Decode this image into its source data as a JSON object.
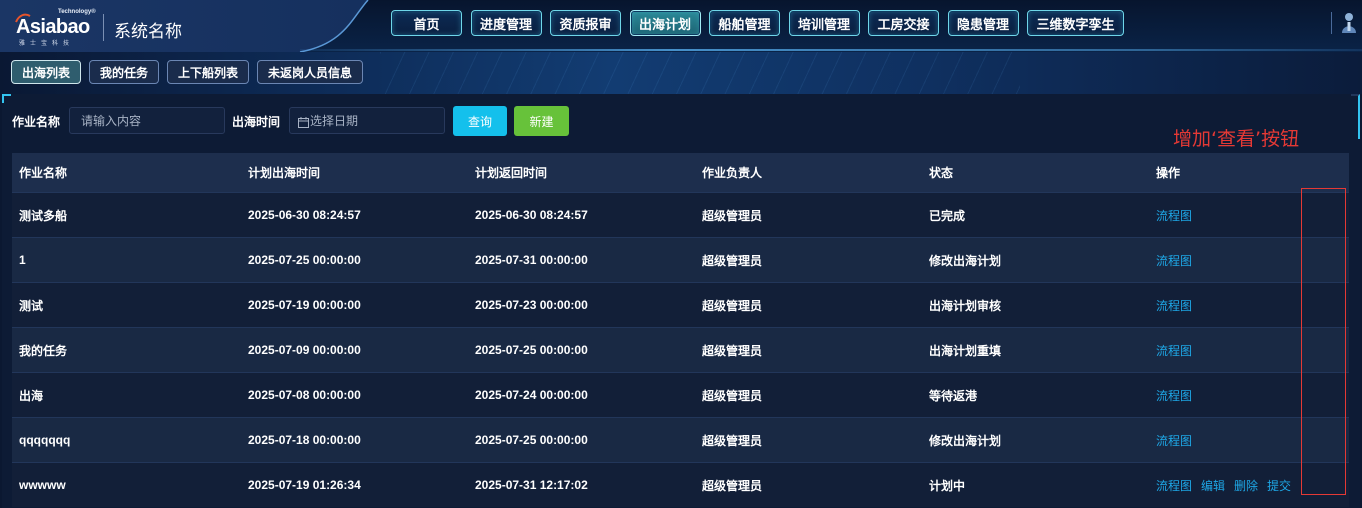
{
  "logo": {
    "brand": "Asiabao",
    "tagline": "Technology®",
    "subtitle": "雅士宝科技"
  },
  "system_name": "系统名称",
  "nav": [
    {
      "label": "首页"
    },
    {
      "label": "进度管理"
    },
    {
      "label": "资质报审"
    },
    {
      "label": "出海计划",
      "active": true
    },
    {
      "label": "船舶管理"
    },
    {
      "label": "培训管理"
    },
    {
      "label": "工房交接"
    },
    {
      "label": "隐患管理"
    },
    {
      "label": "三维数字孪生"
    }
  ],
  "user_icon": "user-icon",
  "subtabs": [
    {
      "label": "出海列表",
      "active": true
    },
    {
      "label": "我的任务"
    },
    {
      "label": "上下船列表"
    },
    {
      "label": "未返岗人员信息"
    }
  ],
  "filter": {
    "name_label": "作业名称",
    "name_placeholder": "请输入内容",
    "date_label": "出海时间",
    "date_placeholder": "选择日期",
    "date_icon": "calendar-icon",
    "query_button": "查询",
    "create_button": "新建"
  },
  "annotation": {
    "text": "增加‘查看’按钮",
    "color": "#e53935"
  },
  "table": {
    "columns": [
      "作业名称",
      "计划出海时间",
      "计划返回时间",
      "作业负责人",
      "状态",
      "操作"
    ],
    "rows": [
      {
        "name": "测试多船",
        "depart": "2025-06-30 08:24:57",
        "return": "2025-06-30 08:24:57",
        "owner": "超级管理员",
        "status": "已完成",
        "actions": [
          "流程图"
        ]
      },
      {
        "name": "1",
        "depart": "2025-07-25 00:00:00",
        "return": "2025-07-31 00:00:00",
        "owner": "超级管理员",
        "status": "修改出海计划",
        "actions": [
          "流程图"
        ]
      },
      {
        "name": "测试",
        "depart": "2025-07-19 00:00:00",
        "return": "2025-07-23 00:00:00",
        "owner": "超级管理员",
        "status": "出海计划审核",
        "actions": [
          "流程图"
        ]
      },
      {
        "name": "我的任务",
        "depart": "2025-07-09 00:00:00",
        "return": "2025-07-25 00:00:00",
        "owner": "超级管理员",
        "status": "出海计划重填",
        "actions": [
          "流程图"
        ]
      },
      {
        "name": "出海",
        "depart": "2025-07-08 00:00:00",
        "return": "2025-07-24 00:00:00",
        "owner": "超级管理员",
        "status": "等待返港",
        "actions": [
          "流程图"
        ]
      },
      {
        "name": "qqqqqqq",
        "depart": "2025-07-18 00:00:00",
        "return": "2025-07-25 00:00:00",
        "owner": "超级管理员",
        "status": "修改出海计划",
        "actions": [
          "流程图"
        ]
      },
      {
        "name": "wwwww",
        "depart": "2025-07-19 01:26:34",
        "return": "2025-07-31 12:17:02",
        "owner": "超级管理员",
        "status": "计划中",
        "actions": [
          "流程图",
          "编辑",
          "删除",
          "提交"
        ]
      }
    ]
  },
  "colors": {
    "page_background": "#0b1831",
    "nav_active": "#23788a",
    "primary_button": "#14c0ec",
    "success_button": "#67c23a",
    "link": "#1ea7e6"
  }
}
